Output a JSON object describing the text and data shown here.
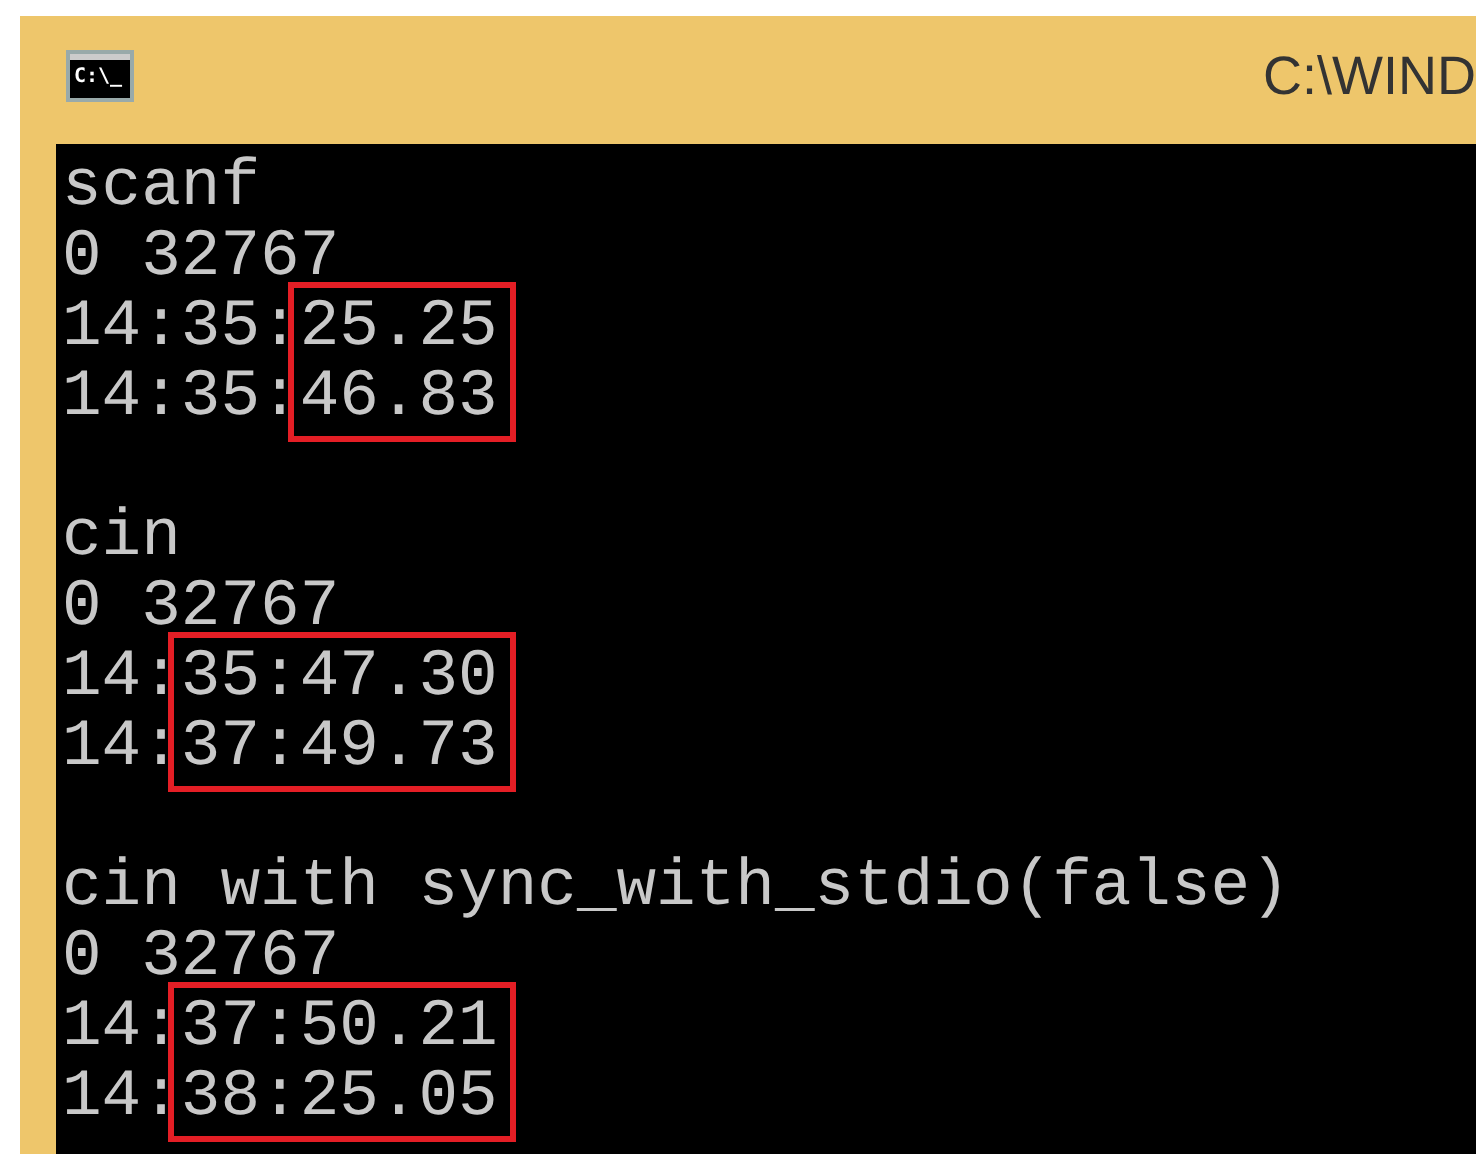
{
  "window": {
    "title": "C:\\WIND",
    "icon_text": "C:\\_"
  },
  "sections": [
    {
      "header": "scanf",
      "range": "0 32767",
      "times": [
        {
          "prefix": "14:35:",
          "marked": "25.25"
        },
        {
          "prefix": "14:35:",
          "marked": "46.83"
        }
      ]
    },
    {
      "header": "cin",
      "range": "0 32767",
      "times": [
        {
          "prefix": "14:",
          "marked": "35:47.30"
        },
        {
          "prefix": "14:",
          "marked": "37:49.73"
        }
      ]
    },
    {
      "header": "cin with sync_with_stdio(false)",
      "range": "0 32767",
      "times": [
        {
          "prefix": "14:",
          "marked": "37:50.21"
        },
        {
          "prefix": "14:",
          "marked": "38:25.05"
        }
      ]
    }
  ]
}
